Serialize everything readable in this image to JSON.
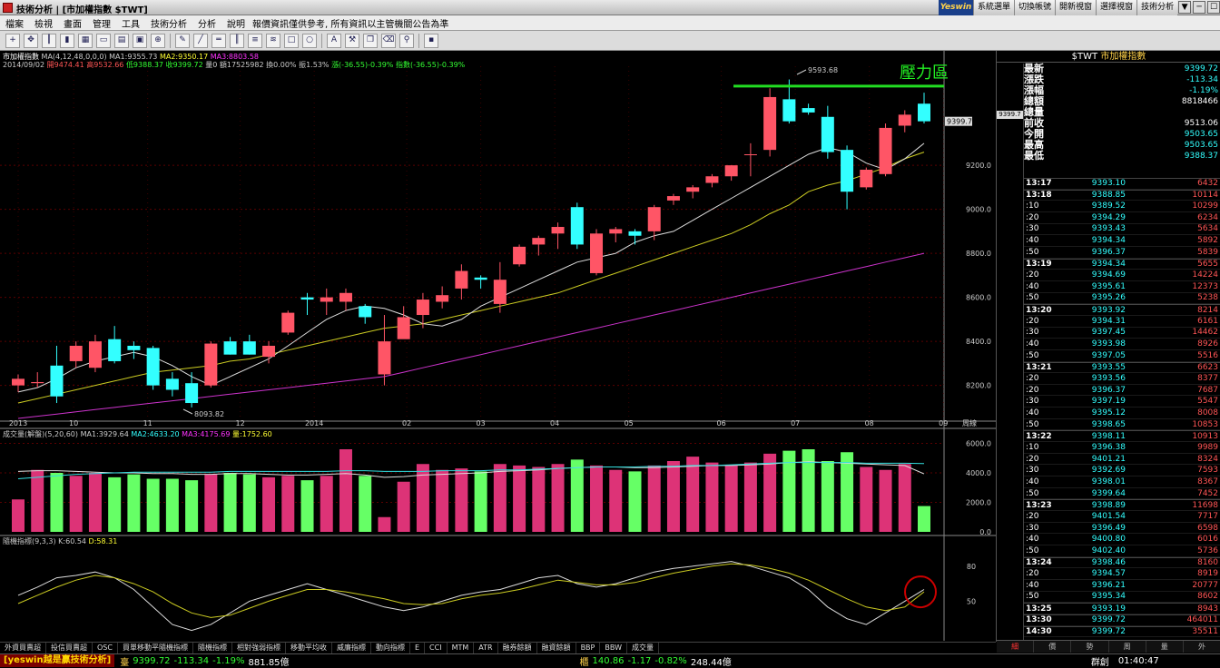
{
  "window": {
    "title": "技術分析 | [市加權指數 $TWT]",
    "logo": "Yeswin",
    "buttons": [
      "系統選單",
      "切換帳號",
      "開新視窗",
      "選擇視窗",
      "技術分析"
    ],
    "controls": [
      "▼",
      "─",
      "☐",
      "✕"
    ]
  },
  "menu": {
    "items": [
      "檔案",
      "檢視",
      "畫面",
      "管理",
      "工具",
      "技術分析",
      "分析",
      "說明"
    ],
    "notice": "報價資訊僅供參考, 所有資訊以主管機關公告為準"
  },
  "toolbar": {
    "icons": [
      "cross",
      "move",
      "bar",
      "candle",
      "grid",
      "window",
      "panel",
      "window2",
      "zoom",
      "pen",
      "line",
      "hline",
      "vline",
      "channel",
      "fib",
      "rect",
      "ellipse",
      "text",
      "tools",
      "copy",
      "erase",
      "pin",
      "save"
    ]
  },
  "chart_header": {
    "ma_line": {
      "name": "市加權指數",
      "ma_params": "MA(4,12,48,0,0,0)",
      "ma1": "MA1:9355.73",
      "ma2": "MA2:9350.17",
      "ma3": "MA3:8803.58"
    },
    "ohlc_line": {
      "date": "2014/09/02",
      "open": "開9474.41",
      "high": "高9532.66",
      "low": "低9388.37",
      "close": "收9399.72",
      "volume": "量0",
      "amount": "額17525982",
      "turnover": "換0.00%",
      "amplitude": "振1.53%",
      "change": "漲(-36.55)-0.39%",
      "index": "指數(-36.55)-0.39%"
    },
    "annotation": "壓力區",
    "high_label": "9593.68",
    "low_label": "8093.82",
    "price_marker": "9399.7",
    "axis_ticks": [
      "9200.0",
      "9000.0",
      "8800.0",
      "8600.0",
      "8400.0",
      "8200.0"
    ],
    "x_labels": [
      "2013",
      "10",
      "11",
      "12",
      "2014",
      "02",
      "03",
      "04",
      "05",
      "06",
      "07",
      "08",
      "09"
    ],
    "period_label": "周線"
  },
  "volume_header": {
    "text": "成交量(解盤)(5,20,60)",
    "ma1": "MA1:3929.64",
    "ma2": "MA2:4633.20",
    "ma3": "MA3:4175.69",
    "vol": "量:1752.60",
    "axis_ticks": [
      "6000.0",
      "4000.0",
      "2000.0",
      "0.0"
    ]
  },
  "kd_header": {
    "text": "隨機指標(9,3,3)",
    "k": "K:60.54",
    "d": "D:58.31",
    "axis_ticks": [
      "80",
      "50"
    ]
  },
  "chart_data": {
    "type": "candlestick",
    "yrange": [
      8050,
      9650
    ],
    "candles": [
      [
        8200,
        8250,
        8170,
        8230
      ],
      [
        8210,
        8260,
        8190,
        8215
      ],
      [
        8290,
        8380,
        8120,
        8150
      ],
      [
        8310,
        8400,
        8280,
        8380
      ],
      [
        8280,
        8430,
        8260,
        8400
      ],
      [
        8410,
        8470,
        8300,
        8310
      ],
      [
        8380,
        8400,
        8320,
        8360
      ],
      [
        8370,
        8380,
        8180,
        8200
      ],
      [
        8230,
        8260,
        8150,
        8180
      ],
      [
        8210,
        8260,
        8100,
        8120
      ],
      [
        8200,
        8400,
        8190,
        8390
      ],
      [
        8400,
        8420,
        8340,
        8340
      ],
      [
        8400,
        8430,
        8340,
        8340
      ],
      [
        8330,
        8400,
        8300,
        8380
      ],
      [
        8440,
        8540,
        8430,
        8530
      ],
      [
        8600,
        8620,
        8520,
        8590
      ],
      [
        8580,
        8640,
        8520,
        8600
      ],
      [
        8580,
        8640,
        8540,
        8620
      ],
      [
        8560,
        8570,
        8480,
        8510
      ],
      [
        8250,
        8520,
        8200,
        8400
      ],
      [
        8410,
        8560,
        8420,
        8510
      ],
      [
        8520,
        8620,
        8460,
        8590
      ],
      [
        8580,
        8650,
        8550,
        8610
      ],
      [
        8640,
        8750,
        8590,
        8720
      ],
      [
        8690,
        8700,
        8640,
        8680
      ],
      [
        8570,
        8760,
        8530,
        8680
      ],
      [
        8750,
        8840,
        8740,
        8830
      ],
      [
        8840,
        8880,
        8790,
        8870
      ],
      [
        8890,
        8940,
        8820,
        8920
      ],
      [
        9010,
        9030,
        8820,
        8840
      ],
      [
        8710,
        8910,
        8700,
        8890
      ],
      [
        8890,
        8920,
        8850,
        8910
      ],
      [
        8900,
        8910,
        8840,
        8880
      ],
      [
        8900,
        9020,
        8860,
        9010
      ],
      [
        9040,
        9070,
        9020,
        9060
      ],
      [
        9080,
        9110,
        9050,
        9100
      ],
      [
        9120,
        9160,
        9100,
        9150
      ],
      [
        9150,
        9200,
        9130,
        9200
      ],
      [
        9250,
        9300,
        9150,
        9250
      ],
      [
        9270,
        9550,
        9240,
        9510
      ],
      [
        9500,
        9590,
        9390,
        9400
      ],
      [
        9460,
        9480,
        9430,
        9440
      ],
      [
        9420,
        9470,
        9230,
        9260
      ],
      [
        9270,
        9290,
        9000,
        9080
      ],
      [
        9100,
        9190,
        9090,
        9180
      ],
      [
        9160,
        9390,
        9150,
        9370
      ],
      [
        9380,
        9450,
        9350,
        9430
      ],
      [
        9480,
        9530,
        9390,
        9400
      ]
    ],
    "ma_white": [
      8170,
      8190,
      8230,
      8280,
      8310,
      8330,
      8350,
      8330,
      8290,
      8240,
      8200,
      8240,
      8280,
      8320,
      8380,
      8440,
      8500,
      8540,
      8560,
      8550,
      8520,
      8480,
      8470,
      8500,
      8560,
      8600,
      8640,
      8680,
      8720,
      8760,
      8780,
      8800,
      8850,
      8880,
      8900,
      8950,
      9000,
      9050,
      9100,
      9150,
      9200,
      9250,
      9280,
      9260,
      9210,
      9180,
      9230,
      9300
    ],
    "ma_yellow": [
      8120,
      8140,
      8160,
      8180,
      8200,
      8220,
      8240,
      8260,
      8270,
      8280,
      8290,
      8310,
      8320,
      8340,
      8360,
      8380,
      8400,
      8420,
      8440,
      8460,
      8470,
      8480,
      8500,
      8520,
      8540,
      8560,
      8580,
      8600,
      8620,
      8650,
      8680,
      8710,
      8740,
      8770,
      8800,
      8830,
      8860,
      8890,
      8930,
      8980,
      9020,
      9080,
      9110,
      9130,
      9160,
      9190,
      9230,
      9260
    ],
    "ma_magenta": [
      8050,
      8060,
      8070,
      8080,
      8090,
      8100,
      8110,
      8120,
      8130,
      8140,
      8150,
      8160,
      8170,
      8180,
      8190,
      8200,
      8210,
      8220,
      8230,
      8240,
      8260,
      8280,
      8300,
      8320,
      8340,
      8360,
      8380,
      8400,
      8420,
      8440,
      8460,
      8480,
      8500,
      8520,
      8540,
      8560,
      8580,
      8600,
      8620,
      8640,
      8660,
      8680,
      8700,
      8720,
      8740,
      8760,
      8780,
      8800
    ],
    "volumes": [
      2200,
      4200,
      4000,
      3800,
      4000,
      3700,
      3900,
      3600,
      3600,
      3500,
      3900,
      4000,
      3900,
      3700,
      3800,
      3500,
      3800,
      5600,
      3800,
      1000,
      3400,
      4600,
      4200,
      4300,
      4100,
      4600,
      4500,
      4400,
      4600,
      4900,
      4500,
      4200,
      4100,
      4500,
      4800,
      5100,
      4700,
      4500,
      4700,
      5300,
      5500,
      5600,
      4800,
      5400,
      4400,
      4200,
      4600,
      1750
    ],
    "vol_ma": [
      4100,
      4150,
      4150,
      4100,
      4050,
      4000,
      4000,
      3950,
      3950,
      3900,
      3900,
      3950,
      3950,
      3900,
      3850,
      3850,
      3900,
      3950,
      3850,
      3700,
      3750,
      3850,
      3900,
      3950,
      4000,
      4100,
      4150,
      4200,
      4300,
      4350,
      4400,
      4400,
      4350,
      4350,
      4400,
      4450,
      4500,
      4500,
      4550,
      4600,
      4700,
      4750,
      4700,
      4650,
      4600,
      4550,
      4500,
      3930
    ],
    "vol_ma2": [
      3600,
      3700,
      3800,
      3900,
      3950,
      4000,
      4050,
      4050,
      4050,
      4050,
      4050,
      4100,
      4100,
      4100,
      4100,
      4100,
      4100,
      4150,
      4150,
      4100,
      4100,
      4100,
      4150,
      4150,
      4150,
      4200,
      4200,
      4250,
      4300,
      4350,
      4400,
      4400,
      4400,
      4450,
      4450,
      4500,
      4500,
      4550,
      4600,
      4650,
      4700,
      4700,
      4700,
      4700,
      4650,
      4650,
      4650,
      4630
    ],
    "k": [
      55,
      62,
      70,
      72,
      75,
      70,
      60,
      45,
      30,
      25,
      30,
      40,
      50,
      55,
      60,
      65,
      60,
      55,
      50,
      45,
      42,
      45,
      50,
      55,
      58,
      60,
      65,
      70,
      72,
      65,
      62,
      65,
      70,
      75,
      78,
      80,
      82,
      84,
      80,
      75,
      70,
      60,
      45,
      35,
      30,
      40,
      50,
      60
    ],
    "d": [
      48,
      55,
      62,
      68,
      72,
      70,
      65,
      58,
      48,
      40,
      36,
      38,
      44,
      50,
      55,
      60,
      60,
      58,
      55,
      52,
      48,
      47,
      48,
      52,
      55,
      57,
      60,
      64,
      68,
      66,
      64,
      64,
      66,
      70,
      74,
      77,
      80,
      82,
      81,
      78,
      74,
      68,
      60,
      52,
      45,
      42,
      45,
      58
    ]
  },
  "right_panel": {
    "title_symbol": "$TWT",
    "title_name": "市加權指數",
    "summary": [
      {
        "k": "最新",
        "v": "9399.72",
        "c": "#33ffff"
      },
      {
        "k": "漲跌",
        "v": "-113.34",
        "c": "#33ffff"
      },
      {
        "k": "漲幅",
        "v": "-1.19%",
        "c": "#33ffff"
      },
      {
        "k": "總額",
        "v": "8818466",
        "c": "#ffffff"
      },
      {
        "k": "總量",
        "v": "",
        "c": "#ffffff"
      },
      {
        "k": "前收",
        "v": "9513.06",
        "c": "#ffffff"
      },
      {
        "k": "今開",
        "v": "9503.65",
        "c": "#33ffff"
      },
      {
        "k": "最高",
        "v": "9503.65",
        "c": "#33ffff"
      },
      {
        "k": "最低",
        "v": "9388.37",
        "c": "#33ffff"
      }
    ],
    "axis_marker": "9399.7",
    "ticks": [
      {
        "t": "13:17",
        "p": "9393.10",
        "q": "6432",
        "m": true
      },
      {
        "t": "13:18",
        "p": "9388.85",
        "q": "10114",
        "m": true
      },
      {
        "t": ":10",
        "p": "9389.52",
        "q": "10299"
      },
      {
        "t": ":20",
        "p": "9394.29",
        "q": "6234"
      },
      {
        "t": ":30",
        "p": "9393.43",
        "q": "5634"
      },
      {
        "t": ":40",
        "p": "9394.34",
        "q": "5892"
      },
      {
        "t": ":50",
        "p": "9396.37",
        "q": "5839"
      },
      {
        "t": "13:19",
        "p": "9394.34",
        "q": "5655",
        "m": true
      },
      {
        "t": ":20",
        "p": "9394.69",
        "q": "14224"
      },
      {
        "t": ":40",
        "p": "9395.61",
        "q": "12373"
      },
      {
        "t": ":50",
        "p": "9395.26",
        "q": "5238"
      },
      {
        "t": "13:20",
        "p": "9393.92",
        "q": "8214",
        "m": true
      },
      {
        "t": ":20",
        "p": "9394.31",
        "q": "6161"
      },
      {
        "t": ":30",
        "p": "9397.45",
        "q": "14462"
      },
      {
        "t": ":40",
        "p": "9393.98",
        "q": "8926"
      },
      {
        "t": ":50",
        "p": "9397.05",
        "q": "5516"
      },
      {
        "t": "13:21",
        "p": "9393.55",
        "q": "6623",
        "m": true
      },
      {
        "t": ":20",
        "p": "9393.56",
        "q": "8377"
      },
      {
        "t": ":20",
        "p": "9396.37",
        "q": "7687"
      },
      {
        "t": ":30",
        "p": "9397.19",
        "q": "5547"
      },
      {
        "t": ":40",
        "p": "9395.12",
        "q": "8008"
      },
      {
        "t": ":50",
        "p": "9398.65",
        "q": "10853"
      },
      {
        "t": "13:22",
        "p": "9398.11",
        "q": "10913",
        "m": true
      },
      {
        "t": ":10",
        "p": "9396.38",
        "q": "9989"
      },
      {
        "t": ":20",
        "p": "9401.21",
        "q": "8324"
      },
      {
        "t": ":30",
        "p": "9392.69",
        "q": "7593"
      },
      {
        "t": ":40",
        "p": "9398.01",
        "q": "8367"
      },
      {
        "t": ":50",
        "p": "9399.64",
        "q": "7452"
      },
      {
        "t": "13:23",
        "p": "9398.89",
        "q": "11698",
        "m": true
      },
      {
        "t": ":20",
        "p": "9401.54",
        "q": "7717"
      },
      {
        "t": ":30",
        "p": "9396.49",
        "q": "6598"
      },
      {
        "t": ":40",
        "p": "9400.80",
        "q": "6016"
      },
      {
        "t": ":50",
        "p": "9402.40",
        "q": "5736"
      },
      {
        "t": "13:24",
        "p": "9398.46",
        "q": "8160",
        "m": true
      },
      {
        "t": ":20",
        "p": "9394.57",
        "q": "8919"
      },
      {
        "t": ":40",
        "p": "9396.21",
        "q": "20777"
      },
      {
        "t": ":50",
        "p": "9395.34",
        "q": "8602"
      },
      {
        "t": "13:25",
        "p": "9393.19",
        "q": "8943",
        "m": true
      },
      {
        "t": "13:30",
        "p": "9399.72",
        "q": "464011",
        "m": true
      },
      {
        "t": "14:30",
        "p": "9399.72",
        "q": "35511",
        "m": true
      }
    ],
    "tabs": [
      "細",
      "價",
      "勢",
      "周",
      "量",
      "外"
    ]
  },
  "bottom_tabs": [
    "外資買賣超",
    "投信買賣超",
    "OSC",
    "買單移動平隨機指標",
    "隨機指標",
    "相對強弱指標",
    "移動平均收",
    "威廉指標",
    "動向指標",
    "E",
    "CCI",
    "MTM",
    "ATR",
    "融券餘額",
    "融資餘額",
    "BBP",
    "BBW",
    "成交量"
  ],
  "status": {
    "brand": "[yeswin越是贏技術分析]",
    "index_label": "臺",
    "index_value": "9399.72",
    "index_change": "-113.34",
    "index_pct": "-1.19%",
    "index_amt": "881.85億",
    "otc_label": "櫃",
    "otc_value": "140.86",
    "otc_change": "-1.17",
    "otc_pct": "-0.82%",
    "otc_amt": "248.44億",
    "right_label": "群創",
    "time": "01:40:47"
  }
}
